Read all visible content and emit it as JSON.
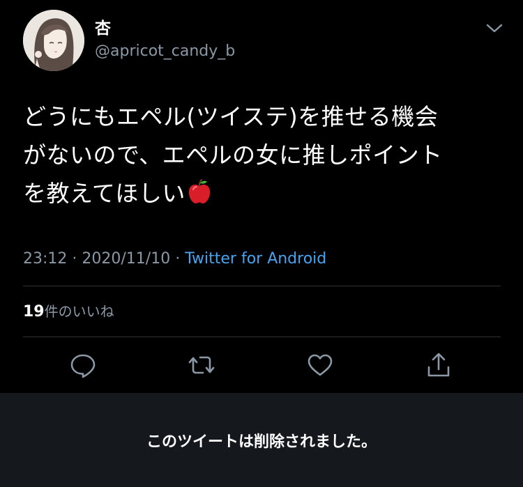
{
  "user": {
    "display_name": "杏",
    "handle": "@apricot_candy_b"
  },
  "tweet": {
    "lines": [
      "どうにもエペル(ツイステ)を推せる機会",
      "がないので、エペルの女に推しポイント",
      "を教えてほしい"
    ],
    "trailing_emoji": "apple-icon"
  },
  "meta": {
    "time": "23:12",
    "separator": "·",
    "date": "2020/11/10",
    "source": "Twitter for Android"
  },
  "likes": {
    "count": "19",
    "label": "件のいいね"
  },
  "actions": [
    "reply-icon",
    "retweet-icon",
    "like-icon",
    "share-icon"
  ],
  "deleted_notice": "このツイートは削除されました。",
  "colors": {
    "background": "#000000",
    "text": "#ffffff",
    "secondary_text": "#8b98a5",
    "link": "#4aa3ee",
    "divider": "#2f3336",
    "banner": "#15181c"
  }
}
